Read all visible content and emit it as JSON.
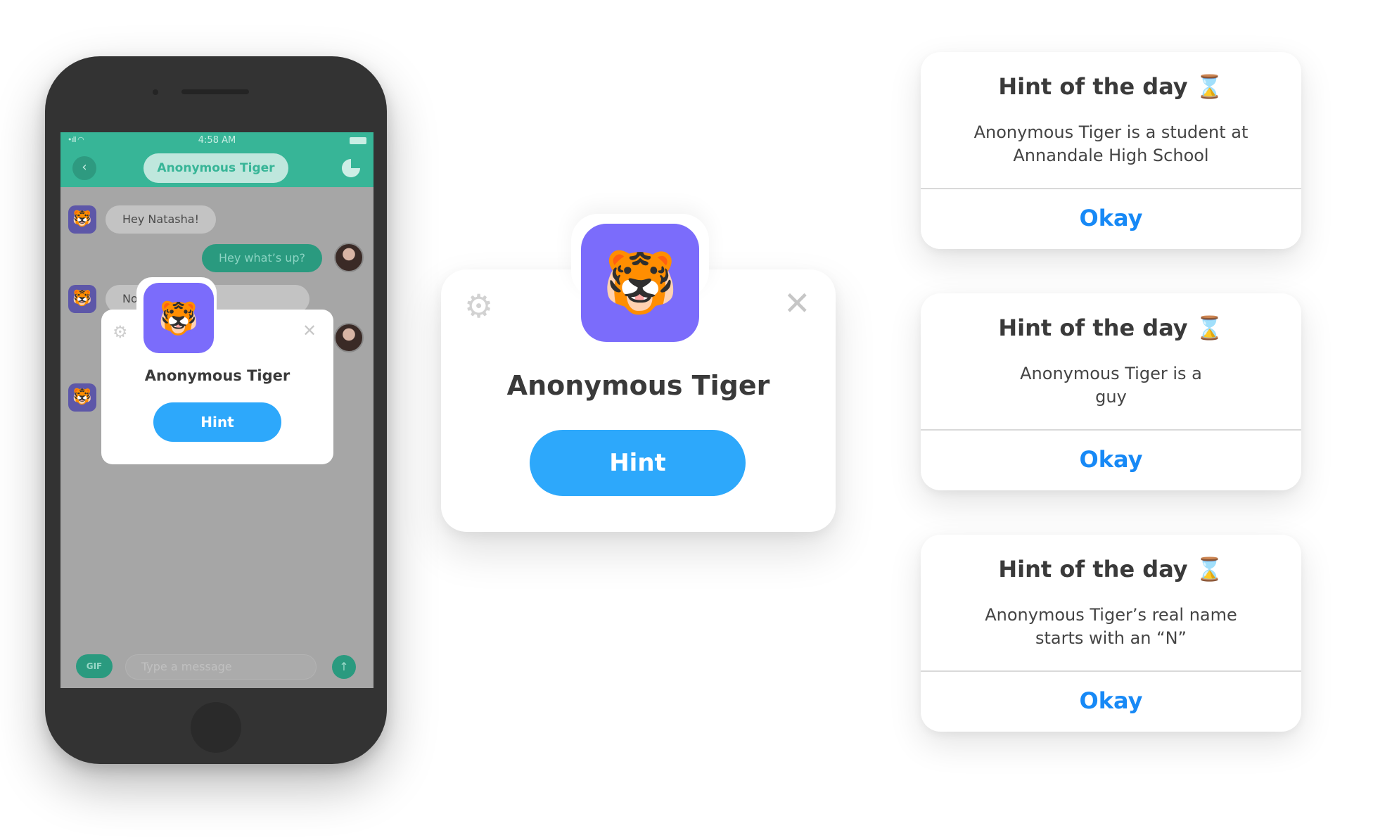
{
  "phone": {
    "status": {
      "signal": "•ıll ◠",
      "time": "4:58 AM"
    },
    "header": {
      "back_icon": "chevron-left-icon",
      "back_glyph": "‹",
      "title": "Anonymous Tiger",
      "progress_icon": "pie-timer-icon",
      "accent": "#37b597"
    },
    "messages": [
      {
        "from": "them",
        "text": "Hey Natasha!"
      },
      {
        "from": "me",
        "text": "Hey what’s up?"
      },
      {
        "from": "them",
        "text": "Not much stats"
      }
    ],
    "tiger_emoji": "🐯",
    "composer": {
      "gif_label": "GIF",
      "placeholder": "Type a message",
      "send_glyph": "↑"
    },
    "popup": {
      "name": "Anonymous Tiger",
      "hint_label": "Hint",
      "gear_glyph": "⚙",
      "close_glyph": "✕"
    }
  },
  "card": {
    "tiger_emoji": "🐯",
    "gear_glyph": "⚙",
    "close_glyph": "✕",
    "name": "Anonymous Tiger",
    "hint_label": "Hint",
    "tile_color": "#7b6cfb",
    "button_color": "#2da8fb"
  },
  "alerts": [
    {
      "title": "Hint of the day",
      "icon": "⌛",
      "body": "Anonymous Tiger is a student at Annandale High School",
      "button": "Okay"
    },
    {
      "title": "Hint of the day",
      "icon": "⌛",
      "body": "Anonymous Tiger is a guy",
      "button": "Okay"
    },
    {
      "title": "Hint of the day",
      "icon": "⌛",
      "body": "Anonymous Tiger’s real name starts with an “N”",
      "button": "Okay"
    }
  ],
  "colors": {
    "link_blue": "#1789f6",
    "text_dark": "#3a3a3a"
  }
}
